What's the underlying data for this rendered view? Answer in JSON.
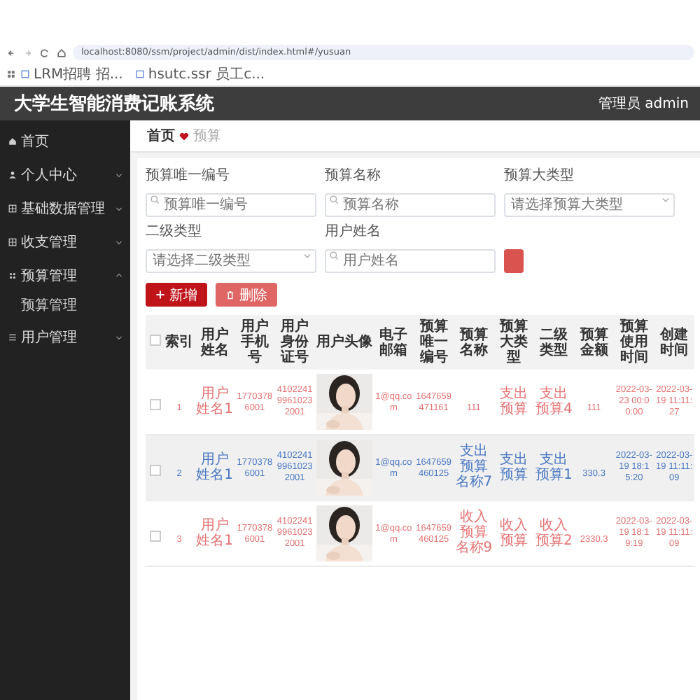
{
  "browser": {
    "url": "localhost:8080/ssm/project/admin/dist/index.html#/yusuan",
    "bookmarks": [
      "LRM招聘 招...",
      "hsutc.ssr 员工c..."
    ]
  },
  "header": {
    "title": "大学生智能消费记账系统",
    "user": "管理员 admin"
  },
  "sidebar": {
    "items": [
      {
        "label": "首页"
      },
      {
        "label": "个人中心",
        "expanded": false
      },
      {
        "label": "基础数据管理",
        "expanded": false
      },
      {
        "label": "收支管理",
        "expanded": false
      },
      {
        "label": "预算管理",
        "expanded": true,
        "children": [
          {
            "label": "预算管理"
          }
        ]
      },
      {
        "label": "用户管理",
        "expanded": false
      }
    ]
  },
  "breadcrumb": [
    "首页",
    "预算"
  ],
  "filters": [
    {
      "label": "预算唯一编号",
      "kind": "input",
      "placeholder": "预算唯一编号"
    },
    {
      "label": "预算名称",
      "kind": "input",
      "placeholder": "预算名称"
    },
    {
      "label": "预算大类型",
      "kind": "select",
      "placeholder": "请选择预算大类型"
    },
    {
      "label": "二级类型",
      "kind": "select",
      "placeholder": "请选择二级类型"
    },
    {
      "label": "用户姓名",
      "kind": "input",
      "placeholder": "用户姓名"
    }
  ],
  "actions": [
    {
      "label": "新增",
      "kind": "add"
    },
    {
      "label": "删除",
      "kind": "delete"
    }
  ],
  "table": {
    "all_checked": false,
    "columns": [
      "索引",
      "用户姓名",
      "用户手机号",
      "用户身份证号",
      "用户头像",
      "电子邮箱",
      "预算唯一编号",
      "预算名称",
      "预算大类型",
      "二级类型",
      "预算金额",
      "预算使用时间",
      "创建时间"
    ],
    "rows": [
      {
        "selected": false,
        "checked": false,
        "cells": [
          "1",
          "用户姓名1",
          "17703786001",
          "410224199610232001",
          {
            "kind": "picture"
          },
          "1@qq.com",
          "1647659471161",
          "111",
          "支出预算",
          "支出预算4",
          "111",
          "2022-03-23 00:00:00",
          "2022-03-19 11:11:27"
        ]
      },
      {
        "selected": true,
        "checked": false,
        "cells": [
          "2",
          "用户姓名1",
          "17703786001",
          "410224199610232001",
          {
            "kind": "picture"
          },
          "1@qq.com",
          "1647659460125",
          "支出预算名称7",
          "支出预算",
          "支出预算1",
          "330.3",
          "2022-03-19 18:15:20",
          "2022-03-19 11:11:09"
        ]
      },
      {
        "selected": false,
        "checked": false,
        "cells": [
          "3",
          "用户姓名1",
          "17703786001",
          "410224199610232001",
          {
            "kind": "picture"
          },
          "1@qq.com",
          "1647659460125",
          "收入预算名称9",
          "收入预算",
          "收入预算2",
          "2330.3",
          "2022-03-19 18:19:19",
          "2022-03-19 11:11:09"
        ]
      }
    ]
  }
}
